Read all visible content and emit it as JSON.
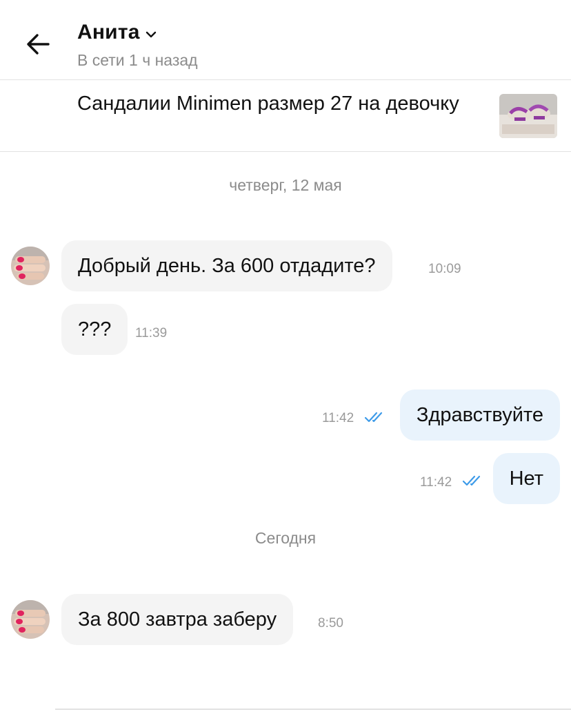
{
  "header": {
    "contact_name": "Анита",
    "status": "В сети 1 ч назад"
  },
  "listing": {
    "title": "Сандалии Minimen размер 27 на девочку"
  },
  "dates": {
    "first": "четверг, 12 мая",
    "second": "Сегодня"
  },
  "messages": [
    {
      "direction": "incoming",
      "text": "Добрый день. За 600 отдадите?",
      "time": "10:09"
    },
    {
      "direction": "incoming",
      "text": "???",
      "time": "11:39"
    },
    {
      "direction": "outgoing",
      "text": "Здравствуйте",
      "time": "11:42",
      "read": true
    },
    {
      "direction": "outgoing",
      "text": "Нет",
      "time": "11:42",
      "read": true
    },
    {
      "direction": "incoming",
      "text": "За 800 завтра заберу",
      "time": "8:50"
    }
  ],
  "colors": {
    "incoming_bubble": "#f4f4f4",
    "outgoing_bubble": "#e9f3fc",
    "read_ticks": "#3d9be9",
    "muted_text": "#8b8b8b"
  },
  "icons": {
    "back": "arrow-left-icon",
    "dropdown": "chevron-down-icon",
    "read_status": "double-check-icon"
  }
}
